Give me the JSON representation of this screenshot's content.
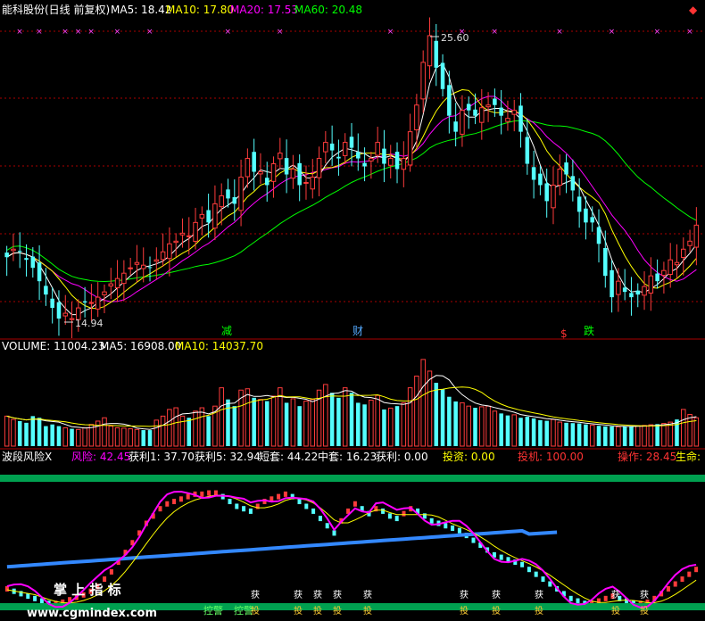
{
  "header": {
    "title": "能科股份(日线 前复权)",
    "ma": [
      {
        "label": "MA5: 18.42",
        "color": "#ffffff"
      },
      {
        "label": "MA10: 17.80",
        "color": "#ffff00"
      },
      {
        "label": "MA20: 17.53",
        "color": "#ff00ff"
      },
      {
        "label": "MA60: 20.48",
        "color": "#00ff00"
      }
    ]
  },
  "price_panel": {
    "high_label": "25.60",
    "low_label": "14.94",
    "signals": [
      {
        "text": "减",
        "color": "#00ff00"
      },
      {
        "text": "财",
        "color": "#55aaff"
      },
      {
        "text": "$",
        "color": "#ff3333"
      },
      {
        "text": "跌",
        "color": "#00ff00"
      }
    ],
    "marker": "××"
  },
  "volume_panel": {
    "labels": [
      {
        "text": "VOLUME: 11004.23",
        "color": "#ffffff"
      },
      {
        "text": "MA5: 16908.00",
        "color": "#ffffff"
      },
      {
        "text": "MA10: 14037.70",
        "color": "#ffff00"
      }
    ]
  },
  "indicator_panel": {
    "labels": [
      {
        "text": "波段风险X",
        "color": "#ffffff"
      },
      {
        "text": "风险: 42.45",
        "color": "#ff00ff"
      },
      {
        "text": "获利1: 37.70",
        "color": "#ffffff"
      },
      {
        "text": "获利5: 32.94",
        "color": "#ffffff"
      },
      {
        "text": "短套: 44.22",
        "color": "#ffffff"
      },
      {
        "text": "中套: 16.23",
        "color": "#ffffff"
      },
      {
        "text": "获利: 0.00",
        "color": "#ffffff"
      },
      {
        "text": "投资: 0.00",
        "color": "#ffff00"
      },
      {
        "text": "投机: 100.00",
        "color": "#ff3333"
      },
      {
        "text": "操作: 28.45",
        "color": "#ff3333"
      },
      {
        "text": "生命:",
        "color": "#ffff00"
      }
    ],
    "tags": [
      "控警",
      "控警",
      "获",
      "投"
    ],
    "watermark": "掌 上 指 标",
    "site": "www.cgmindex.com"
  },
  "colors": {
    "up": "#ff3c3c",
    "down": "#54ffff",
    "ma5": "#ffffff",
    "ma10": "#ffff00",
    "ma20": "#ff00ff",
    "ma60": "#00ff00",
    "grid": "#aa0000",
    "band": "#00a050"
  },
  "chart_data": {
    "type": "candlestick",
    "ylim": [
      14.5,
      26.2
    ],
    "closes": [
      17.3,
      17.6,
      17.5,
      17.2,
      16.9,
      16.4,
      15.9,
      15.4,
      15.0,
      15.2,
      15.0,
      15.4,
      15.6,
      15.6,
      15.8,
      16.0,
      16.3,
      16.5,
      16.7,
      16.9,
      17.1,
      17.0,
      16.9,
      17.2,
      17.5,
      17.8,
      17.9,
      18.2,
      18.1,
      18.6,
      18.9,
      18.6,
      19.3,
      19.6,
      19.5,
      19.3,
      20.3,
      21.0,
      20.5,
      20.5,
      20.0,
      20.8,
      21.2,
      20.4,
      20.6,
      20.0,
      20.1,
      20.3,
      21.0,
      21.6,
      21.3,
      21.0,
      21.6,
      21.4,
      21.0,
      20.7,
      21.0,
      21.6,
      20.8,
      21.0,
      20.6,
      21.0,
      22.0,
      23.0,
      24.6,
      25.6,
      24.4,
      23.6,
      22.6,
      22.0,
      22.8,
      22.8,
      22.6,
      22.9,
      23.0,
      23.0,
      22.6,
      22.5,
      22.8,
      22.0,
      20.8,
      20.2,
      20.0,
      19.4,
      20.0,
      20.6,
      20.4,
      19.8,
      19.0,
      18.6,
      18.6,
      17.8,
      16.6,
      15.8,
      16.4,
      16.0,
      15.8,
      15.9,
      16.2,
      16.6,
      16.4,
      16.8,
      17.2,
      17.1,
      17.6,
      17.9,
      18.5
    ],
    "volumes": [
      9000,
      8000,
      7500,
      7000,
      9000,
      8500,
      6000,
      6500,
      6000,
      5500,
      5200,
      5000,
      5500,
      6500,
      7500,
      8500,
      6000,
      5500,
      5400,
      5200,
      5000,
      4800,
      4800,
      7800,
      9000,
      11000,
      11500,
      9000,
      8500,
      10500,
      11500,
      9000,
      12000,
      17500,
      14000,
      12000,
      16800,
      17200,
      14500,
      14000,
      13500,
      15000,
      17500,
      13000,
      14200,
      12000,
      13500,
      14000,
      16800,
      18500,
      16000,
      14500,
      17500,
      16000,
      13000,
      12500,
      13800,
      15200,
      11000,
      11400,
      12000,
      13000,
      17500,
      21000,
      26000,
      22500,
      19000,
      17000,
      14800,
      13400,
      13000,
      12000,
      11500,
      11800,
      12000,
      10500,
      9800,
      9200,
      9400,
      8500,
      8800,
      8300,
      7800,
      7600,
      8000,
      7200,
      7000,
      6900,
      6800,
      6500,
      6300,
      6100,
      5900,
      5900,
      5800,
      5900,
      6000,
      6100,
      6200,
      6400,
      6600,
      6800,
      7200,
      8000,
      11004,
      9500,
      8500
    ],
    "indicator": [
      14,
      12,
      10,
      8,
      6,
      4,
      2,
      2,
      3,
      5,
      7,
      9,
      12,
      16,
      22,
      28,
      36,
      44,
      52,
      60,
      68,
      74,
      80,
      84,
      86,
      88,
      90,
      92,
      92,
      93,
      93,
      90,
      86,
      82,
      80,
      78,
      82,
      86,
      88,
      90,
      92,
      90,
      86,
      82,
      78,
      72,
      66,
      60,
      70,
      78,
      84,
      80,
      76,
      80,
      78,
      74,
      72,
      76,
      80,
      78,
      74,
      70,
      68,
      66,
      64,
      62,
      58,
      54,
      50,
      46,
      42,
      40,
      38,
      36,
      34,
      30,
      26,
      22,
      18,
      14,
      10,
      6,
      4,
      2,
      2,
      4,
      6,
      8,
      6,
      4,
      2,
      2,
      3,
      6,
      10,
      14,
      18,
      22,
      26,
      30
    ]
  }
}
